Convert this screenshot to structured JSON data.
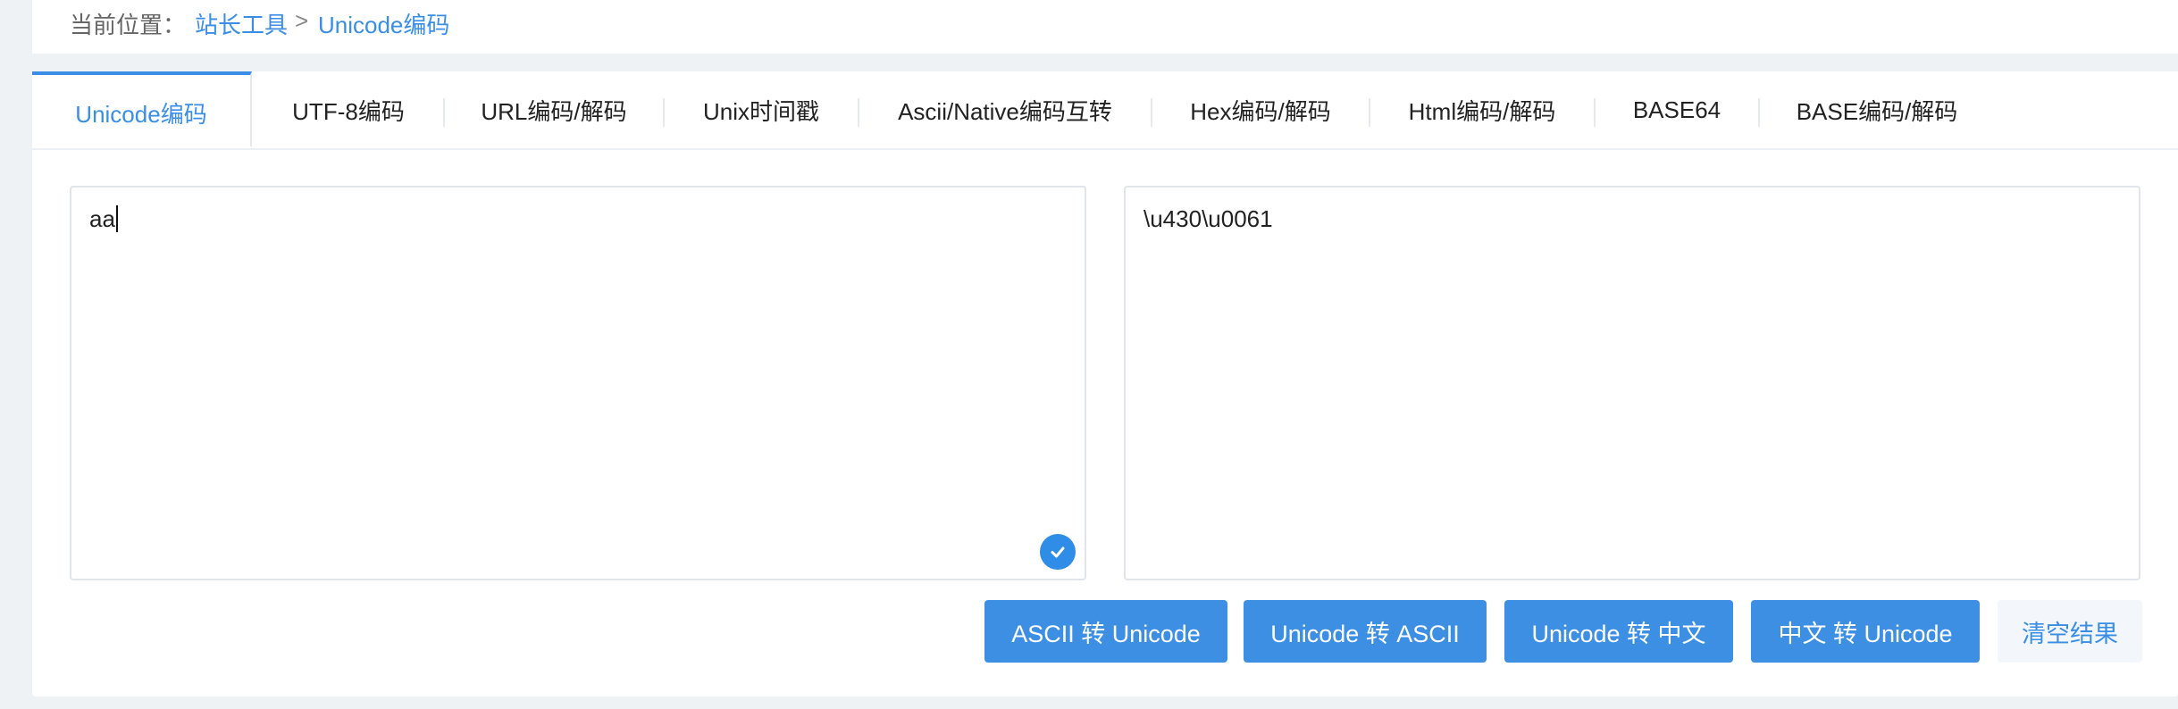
{
  "breadcrumb": {
    "label": "当前位置：",
    "root": "站长工具",
    "separator": ">",
    "current": "Unicode编码"
  },
  "tabs": [
    {
      "label": "Unicode编码",
      "active": true
    },
    {
      "label": "UTF-8编码"
    },
    {
      "label": "URL编码/解码"
    },
    {
      "label": "Unix时间戳"
    },
    {
      "label": "Ascii/Native编码互转"
    },
    {
      "label": "Hex编码/解码"
    },
    {
      "label": "Html编码/解码"
    },
    {
      "label": "BASE64"
    },
    {
      "label": "BASE编码/解码"
    }
  ],
  "input": {
    "value": "aa"
  },
  "output": {
    "value": "\\u430\\u0061"
  },
  "buttons": {
    "ascii_to_unicode": "ASCII 转 Unicode",
    "unicode_to_ascii": "Unicode 转 ASCII",
    "unicode_to_chinese": "Unicode 转 中文",
    "chinese_to_unicode": "中文 转 Unicode",
    "clear": "清空结果"
  },
  "colors": {
    "accent": "#3a8ee6",
    "button": "#3d8fe4",
    "background": "#eef2f5"
  },
  "icons": {
    "input_status": "check-circle-icon"
  }
}
